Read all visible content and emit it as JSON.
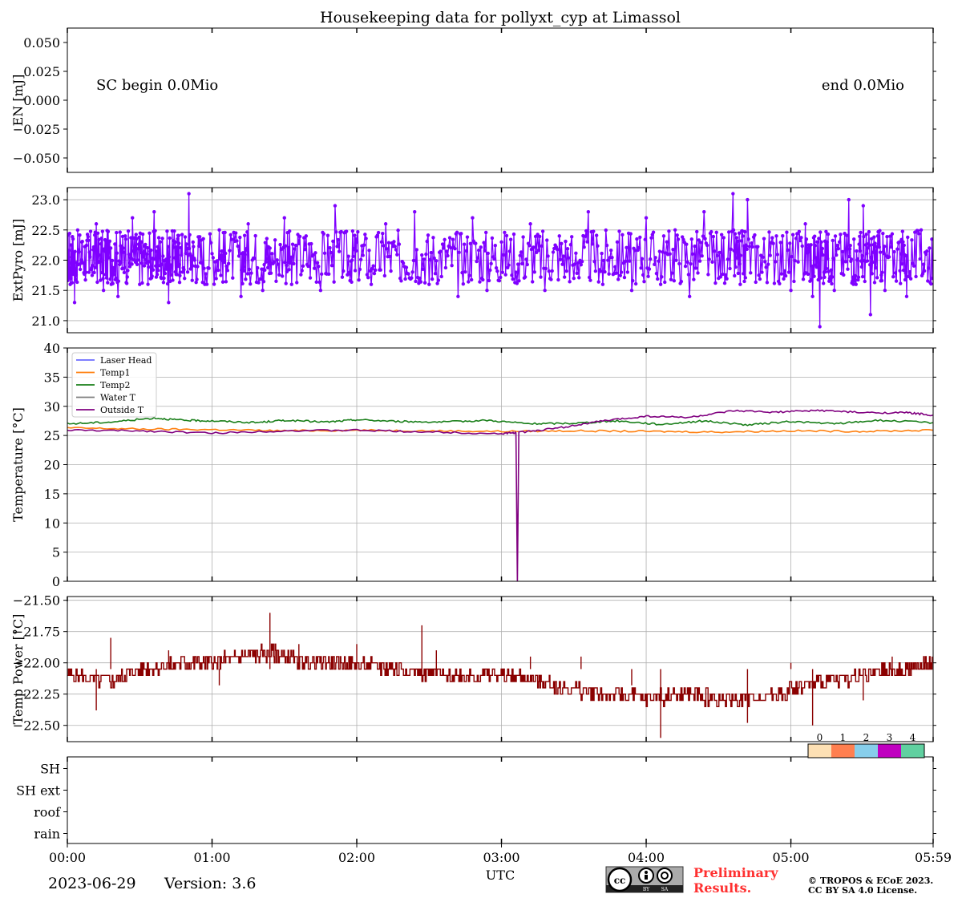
{
  "chart_data": [
    {
      "type": "line",
      "title": "Housekeeping data for pollyxt_cyp at Limassol",
      "ylabel": "EN [mJ]",
      "ylim": [
        -0.0625,
        0.0625
      ],
      "yticks": [
        "0.050",
        "0.025",
        "0.000",
        "−0.025",
        "−0.050"
      ],
      "ytick_values": [
        0.05,
        0.025,
        0,
        -0.025,
        -0.05
      ],
      "annotations": {
        "left": "SC begin 0.0Mio",
        "right": "end 0.0Mio"
      },
      "series": [],
      "grid": false
    },
    {
      "type": "line",
      "ylabel": "ExtPyro [mJ]",
      "ylim": [
        20.8,
        23.2
      ],
      "yticks": [
        "23.0",
        "22.5",
        "22.0",
        "21.5",
        "21.0"
      ],
      "ytick_values": [
        23.0,
        22.5,
        22.0,
        21.5,
        21.0
      ],
      "grid": true,
      "series": [
        {
          "color": "#7f00ff",
          "markers": true,
          "points": [
            [
              0.0,
              22.0
            ],
            [
              0.02,
              21.6
            ],
            [
              0.05,
              21.3
            ],
            [
              0.1,
              22.3
            ],
            [
              0.15,
              21.8
            ],
            [
              0.2,
              22.6
            ],
            [
              0.25,
              21.5
            ],
            [
              0.3,
              22.2
            ],
            [
              0.35,
              21.4
            ],
            [
              0.4,
              22.4
            ],
            [
              0.45,
              22.7
            ],
            [
              0.5,
              21.6
            ],
            [
              0.55,
              22.1
            ],
            [
              0.6,
              22.8
            ],
            [
              0.65,
              21.7
            ],
            [
              0.7,
              21.3
            ],
            [
              0.75,
              22.3
            ],
            [
              0.78,
              21.8
            ],
            [
              0.84,
              23.1
            ],
            [
              0.88,
              22.0
            ],
            [
              0.95,
              21.6
            ],
            [
              1.05,
              22.5
            ],
            [
              1.1,
              21.9
            ],
            [
              1.2,
              21.4
            ],
            [
              1.25,
              22.6
            ],
            [
              1.35,
              21.5
            ],
            [
              1.4,
              22.2
            ],
            [
              1.5,
              22.7
            ],
            [
              1.55,
              21.6
            ],
            [
              1.65,
              22.4
            ],
            [
              1.75,
              21.5
            ],
            [
              1.85,
              22.9
            ],
            [
              1.95,
              21.8
            ],
            [
              2.0,
              22.3
            ],
            [
              2.1,
              21.6
            ],
            [
              2.2,
              22.6
            ],
            [
              2.3,
              21.7
            ],
            [
              2.4,
              22.8
            ],
            [
              2.5,
              21.6
            ],
            [
              2.6,
              22.2
            ],
            [
              2.7,
              21.4
            ],
            [
              2.8,
              22.7
            ],
            [
              2.9,
              21.5
            ],
            [
              3.0,
              22.3
            ],
            [
              3.1,
              21.8
            ],
            [
              3.2,
              22.6
            ],
            [
              3.3,
              21.5
            ],
            [
              3.4,
              22.4
            ],
            [
              3.5,
              21.7
            ],
            [
              3.6,
              22.8
            ],
            [
              3.7,
              21.6
            ],
            [
              3.8,
              22.3
            ],
            [
              3.9,
              21.5
            ],
            [
              4.0,
              22.7
            ],
            [
              4.1,
              21.6
            ],
            [
              4.2,
              22.5
            ],
            [
              4.3,
              21.4
            ],
            [
              4.4,
              22.8
            ],
            [
              4.5,
              21.7
            ],
            [
              4.6,
              23.1
            ],
            [
              4.65,
              21.6
            ],
            [
              4.7,
              23.0
            ],
            [
              4.8,
              21.8
            ],
            [
              4.9,
              22.4
            ],
            [
              5.0,
              21.5
            ],
            [
              5.1,
              22.6
            ],
            [
              5.15,
              21.4
            ],
            [
              5.2,
              20.9
            ],
            [
              5.25,
              22.3
            ],
            [
              5.3,
              21.5
            ],
            [
              5.4,
              23.0
            ],
            [
              5.45,
              21.6
            ],
            [
              5.5,
              22.9
            ],
            [
              5.55,
              21.1
            ],
            [
              5.6,
              22.4
            ],
            [
              5.65,
              21.5
            ],
            [
              5.75,
              22.3
            ],
            [
              5.8,
              21.4
            ],
            [
              5.9,
              22.5
            ],
            [
              5.98,
              21.7
            ]
          ]
        }
      ]
    },
    {
      "type": "line",
      "ylabel": "Temperature [$^\\circ C$]",
      "ylim": [
        0,
        40
      ],
      "yticks": [
        "40",
        "35",
        "30",
        "25",
        "20",
        "15",
        "10",
        "5",
        "0"
      ],
      "ytick_values": [
        40,
        35,
        30,
        25,
        20,
        15,
        10,
        5,
        0
      ],
      "grid": true,
      "legend_position": "upper-left",
      "series": [
        {
          "name": "Laser Head",
          "color": "#6b6bff",
          "points": []
        },
        {
          "name": "Temp1",
          "color": "#ff7f0e",
          "points": [
            [
              0.0,
              26.3
            ],
            [
              0.5,
              26.1
            ],
            [
              1.0,
              26.0
            ],
            [
              1.5,
              25.8
            ],
            [
              2.0,
              25.9
            ],
            [
              2.5,
              25.8
            ],
            [
              3.0,
              25.7
            ],
            [
              3.5,
              25.8
            ],
            [
              4.0,
              25.7
            ],
            [
              4.5,
              25.6
            ],
            [
              5.0,
              25.8
            ],
            [
              5.5,
              25.7
            ],
            [
              5.98,
              25.9
            ]
          ]
        },
        {
          "name": "Temp2",
          "color": "#1a7f1a",
          "points": [
            [
              0.0,
              27.0
            ],
            [
              0.3,
              27.3
            ],
            [
              0.6,
              28.0
            ],
            [
              0.8,
              27.6
            ],
            [
              1.0,
              27.5
            ],
            [
              1.3,
              27.2
            ],
            [
              1.5,
              27.6
            ],
            [
              1.8,
              27.3
            ],
            [
              2.0,
              27.7
            ],
            [
              2.3,
              27.4
            ],
            [
              2.6,
              27.3
            ],
            [
              2.9,
              27.6
            ],
            [
              3.2,
              27.0
            ],
            [
              3.5,
              27.1
            ],
            [
              3.8,
              27.5
            ],
            [
              4.1,
              26.9
            ],
            [
              4.4,
              27.5
            ],
            [
              4.7,
              26.8
            ],
            [
              5.0,
              27.4
            ],
            [
              5.3,
              27.0
            ],
            [
              5.6,
              27.6
            ],
            [
              5.98,
              27.2
            ]
          ]
        },
        {
          "name": "Water T",
          "color": "#7f7f7f",
          "points": []
        },
        {
          "name": "Outside T",
          "color": "#800080",
          "points": [
            [
              0.0,
              25.9
            ],
            [
              0.5,
              25.8
            ],
            [
              1.0,
              25.4
            ],
            [
              1.5,
              25.8
            ],
            [
              2.0,
              25.9
            ],
            [
              2.5,
              25.6
            ],
            [
              3.0,
              25.3
            ],
            [
              3.1,
              25.5
            ],
            [
              3.11,
              0.0
            ],
            [
              3.12,
              25.5
            ],
            [
              3.4,
              26.3
            ],
            [
              3.7,
              27.5
            ],
            [
              4.0,
              28.3
            ],
            [
              4.3,
              28.1
            ],
            [
              4.6,
              29.2
            ],
            [
              4.9,
              29.0
            ],
            [
              5.2,
              29.3
            ],
            [
              5.5,
              28.9
            ],
            [
              5.8,
              28.9
            ],
            [
              5.98,
              28.5
            ]
          ]
        }
      ]
    },
    {
      "type": "line",
      "ylabel": "Temp Power [$^\\circ C$]",
      "ylim": [
        -22.63,
        -21.47
      ],
      "yticks": [
        "−21.50",
        "−21.75",
        "−22.00",
        "−22.25",
        "−22.50"
      ],
      "ytick_values": [
        -21.5,
        -21.75,
        -22.0,
        -22.25,
        -22.5
      ],
      "grid": true,
      "series": [
        {
          "color": "#8b0000",
          "points": [
            [
              0.0,
              -22.1
            ],
            [
              0.3,
              -22.15
            ],
            [
              0.5,
              -22.05
            ],
            [
              0.8,
              -22.0
            ],
            [
              1.0,
              -22.0
            ],
            [
              1.2,
              -21.95
            ],
            [
              1.4,
              -21.92
            ],
            [
              1.6,
              -21.98
            ],
            [
              1.8,
              -22.0
            ],
            [
              2.0,
              -22.02
            ],
            [
              2.3,
              -22.05
            ],
            [
              2.6,
              -22.1
            ],
            [
              2.9,
              -22.1
            ],
            [
              3.2,
              -22.12
            ],
            [
              3.4,
              -22.2
            ],
            [
              3.7,
              -22.25
            ],
            [
              4.0,
              -22.28
            ],
            [
              4.3,
              -22.25
            ],
            [
              4.6,
              -22.3
            ],
            [
              4.9,
              -22.25
            ],
            [
              5.2,
              -22.15
            ],
            [
              5.5,
              -22.1
            ],
            [
              5.8,
              -22.05
            ],
            [
              5.98,
              -22.0
            ]
          ],
          "spikes": [
            [
              0.2,
              -22.38
            ],
            [
              0.3,
              -21.8
            ],
            [
              0.7,
              -21.9
            ],
            [
              1.05,
              -22.18
            ],
            [
              1.4,
              -21.6
            ],
            [
              1.6,
              -21.85
            ],
            [
              2.0,
              -21.85
            ],
            [
              2.45,
              -21.7
            ],
            [
              2.55,
              -21.9
            ],
            [
              3.2,
              -21.95
            ],
            [
              3.55,
              -21.95
            ],
            [
              3.9,
              -22.18
            ],
            [
              4.1,
              -22.6
            ],
            [
              4.35,
              -22.05
            ],
            [
              4.7,
              -22.48
            ],
            [
              5.0,
              -22.0
            ],
            [
              5.15,
              -22.5
            ],
            [
              5.5,
              -22.3
            ],
            [
              5.7,
              -21.95
            ],
            [
              5.9,
              -22.0
            ]
          ]
        }
      ]
    },
    {
      "type": "heatmap",
      "ylabel": "",
      "rows": [
        "SH",
        "SH ext",
        "roof",
        "rain"
      ],
      "colorbar": {
        "ticks": [
          "0",
          "1",
          "2",
          "3",
          "4"
        ],
        "colors": [
          "#fde0b4",
          "#ff7f50",
          "#87ceeb",
          "#c000c0",
          "#60d0a0"
        ]
      },
      "xlabel": "UTC",
      "xticks": [
        "00:00",
        "01:00",
        "02:00",
        "03:00",
        "04:00",
        "05:00",
        "05:59"
      ],
      "xtick_values": [
        0,
        1,
        2,
        3,
        4,
        5,
        5.983
      ],
      "xlim": [
        0,
        5.983
      ]
    }
  ],
  "footer": {
    "date": "2023-06-29",
    "version": "Version: 3.6",
    "preliminary_line1": "Preliminary",
    "preliminary_line2": "Results.",
    "copyright_line1": "© TROPOS & ECoE 2023.",
    "copyright_line2": "CC BY SA 4.0 License.",
    "cc_badge_labels": [
      "BY",
      "SA"
    ],
    "preliminary_color": "#ff3030"
  }
}
